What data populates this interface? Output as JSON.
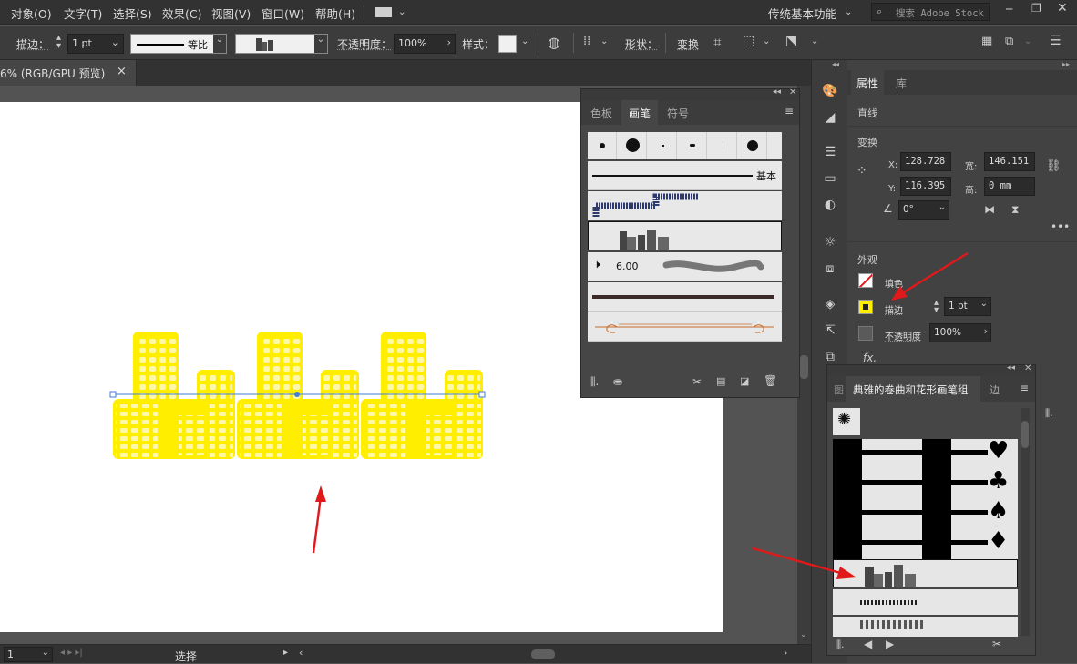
{
  "menu": {
    "items": [
      "对象(O)",
      "文字(T)",
      "选择(S)",
      "效果(C)",
      "视图(V)",
      "窗口(W)",
      "帮助(H)"
    ],
    "workspace": "传统基本功能",
    "search_placeholder": "搜索 Adobe Stock"
  },
  "control_bar": {
    "stroke_label": "描边：",
    "stroke_value": "1 pt",
    "profile_label": "等比",
    "opacity_label": "不透明度：",
    "opacity_value": "100%",
    "style_label": "样式：",
    "shape_label": "形状：",
    "transform_label": "变换"
  },
  "doc_tab": {
    "title": "6% (RGB/GPU 预览)",
    "close": "×"
  },
  "status_bar": {
    "zoom": "1",
    "tool": "选择"
  },
  "brushes_panel": {
    "tabs": [
      "色板",
      "画笔",
      "符号"
    ],
    "active_tab": "画笔",
    "basic_label": "基本",
    "size_value": "6.00"
  },
  "properties_panel": {
    "tabs": [
      "属性",
      "库"
    ],
    "active_tab": "属性",
    "object_type": "直线",
    "transform_title": "变换",
    "x_label": "X:",
    "x_value": "128.728",
    "y_label": "Y:",
    "y_value": "116.395",
    "w_label": "宽:",
    "w_value": "146.151",
    "h_label": "高:",
    "h_value": "0 mm",
    "angle_value": "0°",
    "appearance_title": "外观",
    "fill_label": "填色",
    "stroke_label": "描边",
    "stroke_value": "1 pt",
    "opacity_label": "不透明度",
    "opacity_value": "100%",
    "fx_label": "fx."
  },
  "library_panel": {
    "tab_left": "图",
    "title": "典雅的卷曲和花形画笔组",
    "tab_right": "边"
  },
  "colors": {
    "accent_red": "#e0191b",
    "artwork_yellow": "#ffee00",
    "selection_blue": "#3f7fd6"
  }
}
